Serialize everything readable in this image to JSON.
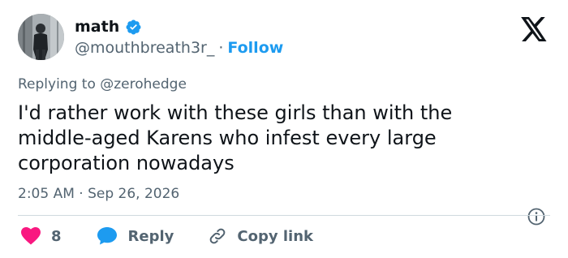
{
  "author": {
    "name": "math",
    "handle": "@mouthbreath3r_",
    "separator": "·",
    "follow_label": "Follow"
  },
  "reply_context": {
    "prefix": "Replying to",
    "mention": "@zerohedge"
  },
  "tweet": {
    "text": "I'd rather work with these girls than with the\nmiddle-aged Karens who infest every large\ncorporation nowadays",
    "timestamp": "2:05 AM · Sep 26, 2026"
  },
  "actions": {
    "like_count": "8",
    "reply_label": "Reply",
    "copy_label": "Copy link"
  },
  "colors": {
    "accent": "#1d9bf0",
    "like": "#f91880",
    "secondary_text": "#536471",
    "divider": "#cfd9de"
  },
  "icons": [
    "verified-badge-icon",
    "x-logo-icon",
    "info-icon",
    "heart-icon",
    "reply-bubble-icon",
    "link-icon"
  ]
}
